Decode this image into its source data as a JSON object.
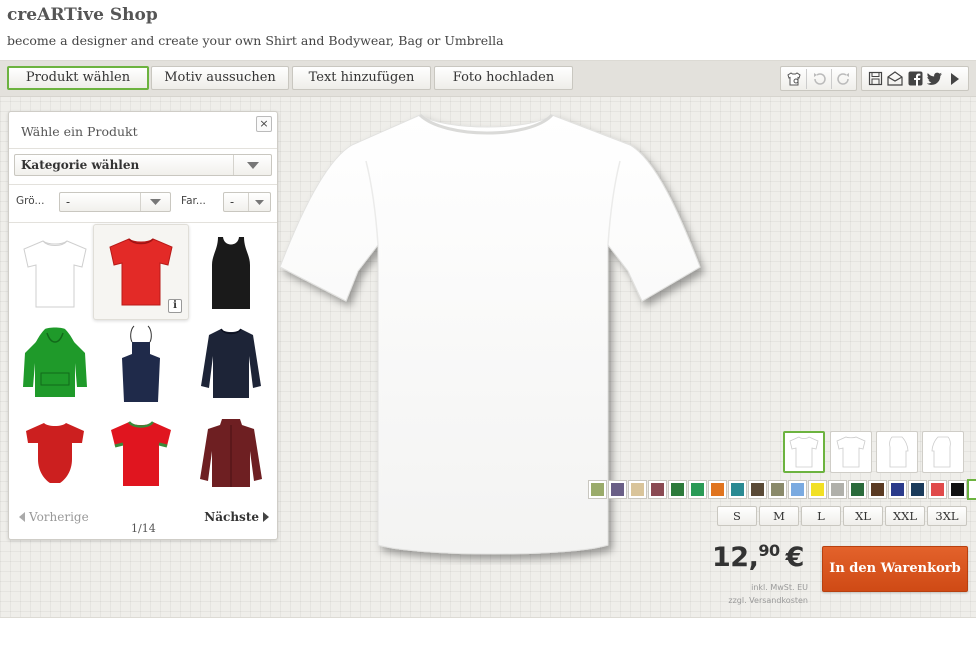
{
  "header": {
    "title": "creARTive Shop",
    "subtitle": "become a designer and create your own Shirt and Bodywear, Bag or Umbrella"
  },
  "toolbar": {
    "tabs": [
      {
        "label": "Produkt wählen",
        "active": true
      },
      {
        "label": "Motiv aussuchen",
        "active": false
      },
      {
        "label": "Text hinzufügen",
        "active": false
      },
      {
        "label": "Foto hochladen",
        "active": false
      }
    ],
    "icons_left": [
      "shirt-settings-icon",
      "undo-icon",
      "redo-icon"
    ],
    "icons_right": [
      "save-icon",
      "email-icon",
      "facebook-icon",
      "twitter-icon",
      "play-icon"
    ]
  },
  "panel": {
    "title": "Wähle ein Produkt",
    "close_label": "×",
    "category_select": "Kategorie wählen",
    "size_label": "Grö...",
    "size_value": "-",
    "color_label": "Far...",
    "color_value": "-",
    "products": [
      {
        "name": "white-tshirt",
        "color": "#ffffff"
      },
      {
        "name": "red-tshirt",
        "color": "#e32a27",
        "selected": true
      },
      {
        "name": "black-tanktop",
        "color": "#1a1a1a"
      },
      {
        "name": "green-hoodie",
        "color": "#1f9a2a"
      },
      {
        "name": "navy-apron",
        "color": "#1f2a4a"
      },
      {
        "name": "navy-longsleeve",
        "color": "#1d2437"
      },
      {
        "name": "red-baby-body",
        "color": "#cc1f1f"
      },
      {
        "name": "red-ringer-tshirt",
        "color": "#e0151f"
      },
      {
        "name": "maroon-jacket",
        "color": "#6e1f22"
      }
    ],
    "info_label": "i",
    "prev_label": "Vorherige",
    "next_label": "Nächste",
    "page_count": "1/14"
  },
  "views": [
    {
      "name": "front",
      "selected": true
    },
    {
      "name": "back",
      "selected": false
    },
    {
      "name": "left",
      "selected": false
    },
    {
      "name": "right",
      "selected": false
    }
  ],
  "colors": [
    "#9aab6a",
    "#6a5f86",
    "#d9c49a",
    "#8a4a52",
    "#2d7a3a",
    "#2a9a55",
    "#e0741e",
    "#2a8a92",
    "#5a4a36",
    "#8a8a6a",
    "#7aaae0",
    "#f2e024",
    "#b0b0aa",
    "#2a6a3a",
    "#5a3a22",
    "#2a3a8a",
    "#1a3a5a",
    "#e04a4a",
    "#111111",
    "#ffffff"
  ],
  "selected_color": "#ffffff",
  "sizes": [
    "S",
    "M",
    "L",
    "XL",
    "XXL",
    "3XL"
  ],
  "price": {
    "main": "12,",
    "cents": "90",
    "currency": "€",
    "note1": "inkl. MwSt. EU",
    "note2": "zzgl. Versandkosten"
  },
  "cart_button": "In den Warenkorb"
}
